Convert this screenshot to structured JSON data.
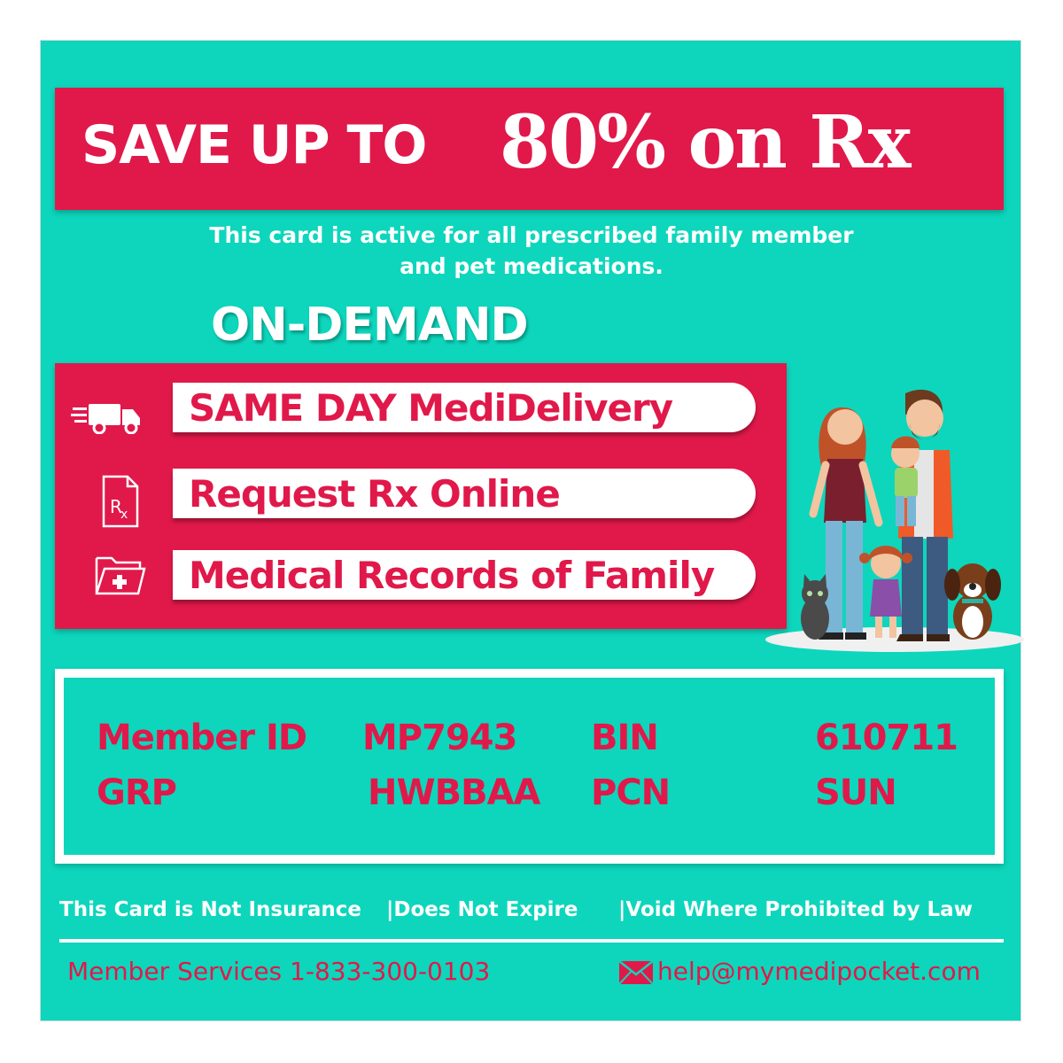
{
  "banner": {
    "line_a": "SAVE UP TO",
    "line_b": "80% on Rx"
  },
  "subtitle": {
    "line1": "This card is active for all prescribed family member",
    "line2": "and pet medications."
  },
  "on_demand": "ON-DEMAND",
  "features": [
    {
      "label": "SAME DAY MediDelivery",
      "icon": "delivery-truck-icon"
    },
    {
      "label": "Request Rx Online",
      "icon": "rx-document-icon"
    },
    {
      "label": "Medical Records of Family",
      "icon": "medical-folder-icon"
    }
  ],
  "member": {
    "id_label": "Member ID",
    "id_value": "MP7943",
    "bin_label": "BIN",
    "bin_value": "610711",
    "grp_label": "GRP",
    "grp_value": "HWBBAA",
    "pcn_label": "PCN",
    "pcn_value": "SUN"
  },
  "disclaimers": [
    "This Card is Not Insurance",
    "|Does Not Expire",
    "|Void Where Prohibited by Law"
  ],
  "contact": {
    "phone": "Member Services 1-833-300-0103",
    "email": "help@mymedipocket.com"
  },
  "colors": {
    "accent": "#e0194a",
    "background": "#0dd6bc",
    "text_light": "#ffffff"
  }
}
